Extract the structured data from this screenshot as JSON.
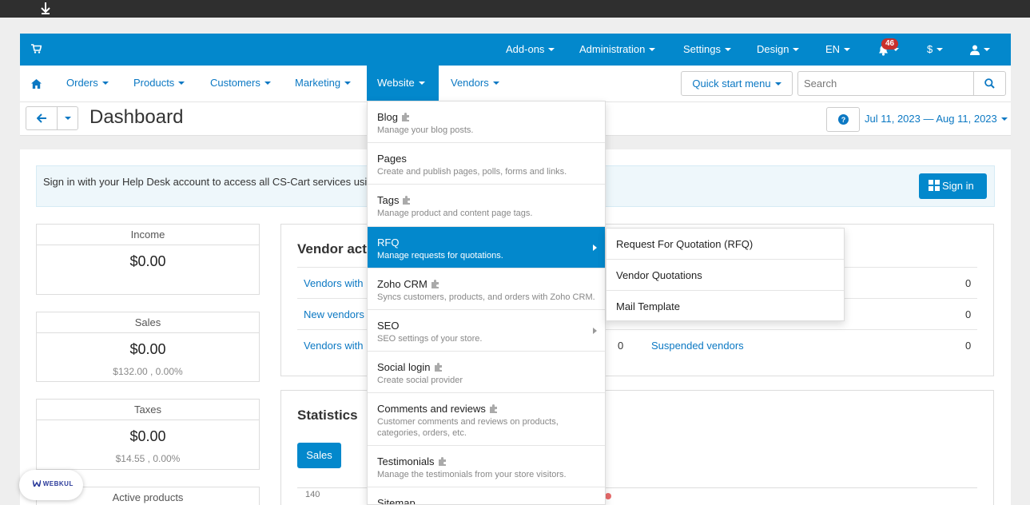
{
  "topbar": {
    "items": [
      {
        "label": "Add-ons"
      },
      {
        "label": "Administration"
      },
      {
        "label": "Settings"
      },
      {
        "label": "Design"
      },
      {
        "label": "EN"
      }
    ],
    "notification_count": "46",
    "currency": "$"
  },
  "mainnav": {
    "items": [
      {
        "label": "Orders"
      },
      {
        "label": "Products"
      },
      {
        "label": "Customers"
      },
      {
        "label": "Marketing"
      },
      {
        "label": "Website"
      },
      {
        "label": "Vendors"
      }
    ],
    "quick_start": "Quick start menu",
    "search_placeholder": "Search"
  },
  "page": {
    "title": "Dashboard",
    "date_range": "Jul 11, 2023 — Aug 11, 2023"
  },
  "notice": {
    "text": "Sign in with your Help Desk account to access all CS-Cart services usi",
    "button": "Sign in"
  },
  "stats": [
    {
      "label": "Income",
      "value": "$0.00",
      "sub": ""
    },
    {
      "label": "Sales",
      "value": "$0.00",
      "sub": "$132.00 , 0.00%"
    },
    {
      "label": "Taxes",
      "value": "$0.00",
      "sub": "$14.55 , 0.00%"
    },
    {
      "label": "Active products",
      "value": "",
      "sub": ""
    }
  ],
  "vendor_activity": {
    "title": "Vendor acti",
    "rows": [
      {
        "left": "Vendors with",
        "left_num": "",
        "right": "",
        "right_num": "0"
      },
      {
        "left": "New vendors",
        "left_num": "",
        "right": "",
        "right_num": "0"
      },
      {
        "left": "Vendors with",
        "left_num": "0",
        "right": "Suspended vendors",
        "right_num": "0"
      }
    ]
  },
  "statistics": {
    "title": "Statistics",
    "tab": "Sales",
    "axis_top": "140"
  },
  "website_menu": [
    {
      "title": "Blog",
      "desc": "Manage your blog posts."
    },
    {
      "title": "Pages",
      "desc": "Create and publish pages, polls, forms and links."
    },
    {
      "title": "Tags",
      "desc": "Manage product and content page tags."
    },
    {
      "title": "RFQ",
      "desc": "Manage requests for quotations."
    },
    {
      "title": "Zoho CRM",
      "desc": "Syncs customers, products, and orders with Zoho CRM."
    },
    {
      "title": "SEO",
      "desc": "SEO settings of your store."
    },
    {
      "title": "Social login",
      "desc": "Create social provider"
    },
    {
      "title": "Comments and reviews",
      "desc": "Customer comments and reviews on products, categories, orders, etc."
    },
    {
      "title": "Testimonials",
      "desc": "Manage the testimonials from your store visitors."
    },
    {
      "title": "Sitemap",
      "desc": ""
    }
  ],
  "rfq_submenu": [
    {
      "label": "Request For Quotation (RFQ)"
    },
    {
      "label": "Vendor Quotations"
    },
    {
      "label": "Mail Template"
    }
  ],
  "webkul": {
    "logo_text": "WEBKUL"
  },
  "colors": {
    "primary": "#0388cc",
    "link": "#0b78c3",
    "badge": "#c9302c",
    "topstrip": "#2f2f2f"
  }
}
